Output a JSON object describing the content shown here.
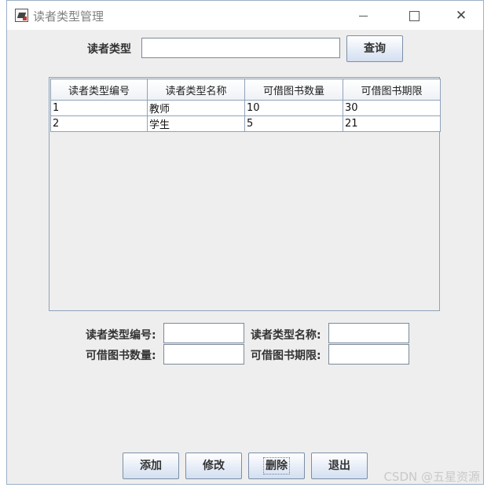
{
  "window": {
    "title": "读者类型管理"
  },
  "search": {
    "label": "读者类型",
    "value": "",
    "button": "查询"
  },
  "table": {
    "headers": [
      "读者类型编号",
      "读者类型名称",
      "可借图书数量",
      "可借图书期限"
    ],
    "rows": [
      [
        "1",
        "教师",
        "10",
        "30"
      ],
      [
        "2",
        "学生",
        "5",
        "21"
      ]
    ]
  },
  "form": {
    "id_label": "读者类型编号:",
    "name_label": "读者类型名称:",
    "count_label": "可借图书数量:",
    "period_label": "可借图书期限:",
    "id_value": "",
    "name_value": "",
    "count_value": "",
    "period_value": ""
  },
  "actions": {
    "add": "添加",
    "edit": "修改",
    "delete": "删除",
    "exit": "退出"
  },
  "watermark": "CSDN @五星资源"
}
